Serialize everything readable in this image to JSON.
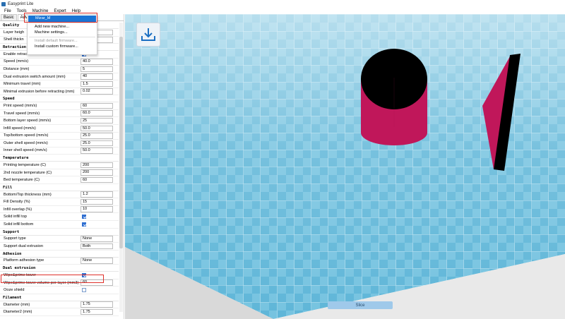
{
  "window": {
    "title": "Easyprint Lite"
  },
  "menubar": [
    "File",
    "Tools",
    "Machine",
    "Expert",
    "Help"
  ],
  "tabs": [
    "Basic",
    "Adv"
  ],
  "machine_menu": {
    "items": [
      {
        "label": "Mizar_M",
        "state": "selected"
      },
      {
        "label": "Add new machine...",
        "state": "normal"
      },
      {
        "label": "Machine settings...",
        "state": "normal"
      },
      {
        "label": "Install default firmware...",
        "state": "disabled"
      },
      {
        "label": "Install custom firmware...",
        "state": "normal"
      }
    ]
  },
  "settings": [
    {
      "type": "section",
      "label": "Quality"
    },
    {
      "type": "field",
      "label": "Layer heigh",
      "value": ""
    },
    {
      "type": "field",
      "label": "Shell thickn",
      "value": ""
    },
    {
      "type": "section",
      "label": "Retraction"
    },
    {
      "type": "check",
      "label": "Enable retraction",
      "checked": true
    },
    {
      "type": "field",
      "label": "Speed (mm/s)",
      "value": "40.0"
    },
    {
      "type": "field",
      "label": "Distance (mm)",
      "value": "5"
    },
    {
      "type": "field",
      "label": "Dual extrusion switch amount (mm)",
      "value": "40"
    },
    {
      "type": "field",
      "label": "Minimum travel (mm)",
      "value": "1.5"
    },
    {
      "type": "field",
      "label": "Minimal extrusion before retracting (mm)",
      "value": "0.02"
    },
    {
      "type": "section",
      "label": "Speed"
    },
    {
      "type": "field",
      "label": "Print speed (mm/s)",
      "value": "60"
    },
    {
      "type": "field",
      "label": "Travel speed (mm/s)",
      "value": "60.0"
    },
    {
      "type": "field",
      "label": "Bottom layer speed (mm/s)",
      "value": "25"
    },
    {
      "type": "field",
      "label": "Infill speed (mm/s)",
      "value": "50.0"
    },
    {
      "type": "field",
      "label": "Top/bottom speed (mm/s)",
      "value": "25.0"
    },
    {
      "type": "field",
      "label": "Outer shell speed (mm/s)",
      "value": "25.0"
    },
    {
      "type": "field",
      "label": "Inner shell speed (mm/s)",
      "value": "50.0"
    },
    {
      "type": "section",
      "label": "Temperature"
    },
    {
      "type": "field",
      "label": "Printing temperature (C)",
      "value": "200"
    },
    {
      "type": "field",
      "label": "2nd nozzle temperature (C)",
      "value": "200"
    },
    {
      "type": "field",
      "label": "Bed temperature (C)",
      "value": "60"
    },
    {
      "type": "section",
      "label": "Fill"
    },
    {
      "type": "field",
      "label": "Bottom/Top thickness (mm)",
      "value": "1.2"
    },
    {
      "type": "field",
      "label": "Fill Density (%)",
      "value": "15"
    },
    {
      "type": "field",
      "label": "Infill overlap (%)",
      "value": "10"
    },
    {
      "type": "check",
      "label": "Solid infill top",
      "checked": true
    },
    {
      "type": "check",
      "label": "Solid infill bottom",
      "checked": true
    },
    {
      "type": "section",
      "label": "Support"
    },
    {
      "type": "field",
      "label": "Support type",
      "value": "None"
    },
    {
      "type": "field",
      "label": "Support dual extrusion",
      "value": "Both"
    },
    {
      "type": "section",
      "label": "Adhesion"
    },
    {
      "type": "field",
      "label": "Platform adhesion type",
      "value": "None"
    },
    {
      "type": "section",
      "label": "Dual extrusion"
    },
    {
      "type": "check",
      "label": "Wipe&prime tower",
      "checked": true
    },
    {
      "type": "field",
      "label": "Wipe&prime tower volume per layer (mm3)",
      "value": "60"
    },
    {
      "type": "check",
      "label": "Ooze shield",
      "checked": false
    },
    {
      "type": "section",
      "label": "Filament"
    },
    {
      "type": "field",
      "label": "Diameter (mm)",
      "value": "1.75"
    },
    {
      "type": "field",
      "label": "Diameter2 (mm)",
      "value": "1.75"
    }
  ],
  "viewport": {
    "slice_label": "Slice",
    "load_icon": "download-tray-icon",
    "colors": {
      "floor": "#5ab3d6",
      "floor_light": "#7cc5e2",
      "model_side": "#c0175a",
      "model_top": "#000000"
    }
  }
}
